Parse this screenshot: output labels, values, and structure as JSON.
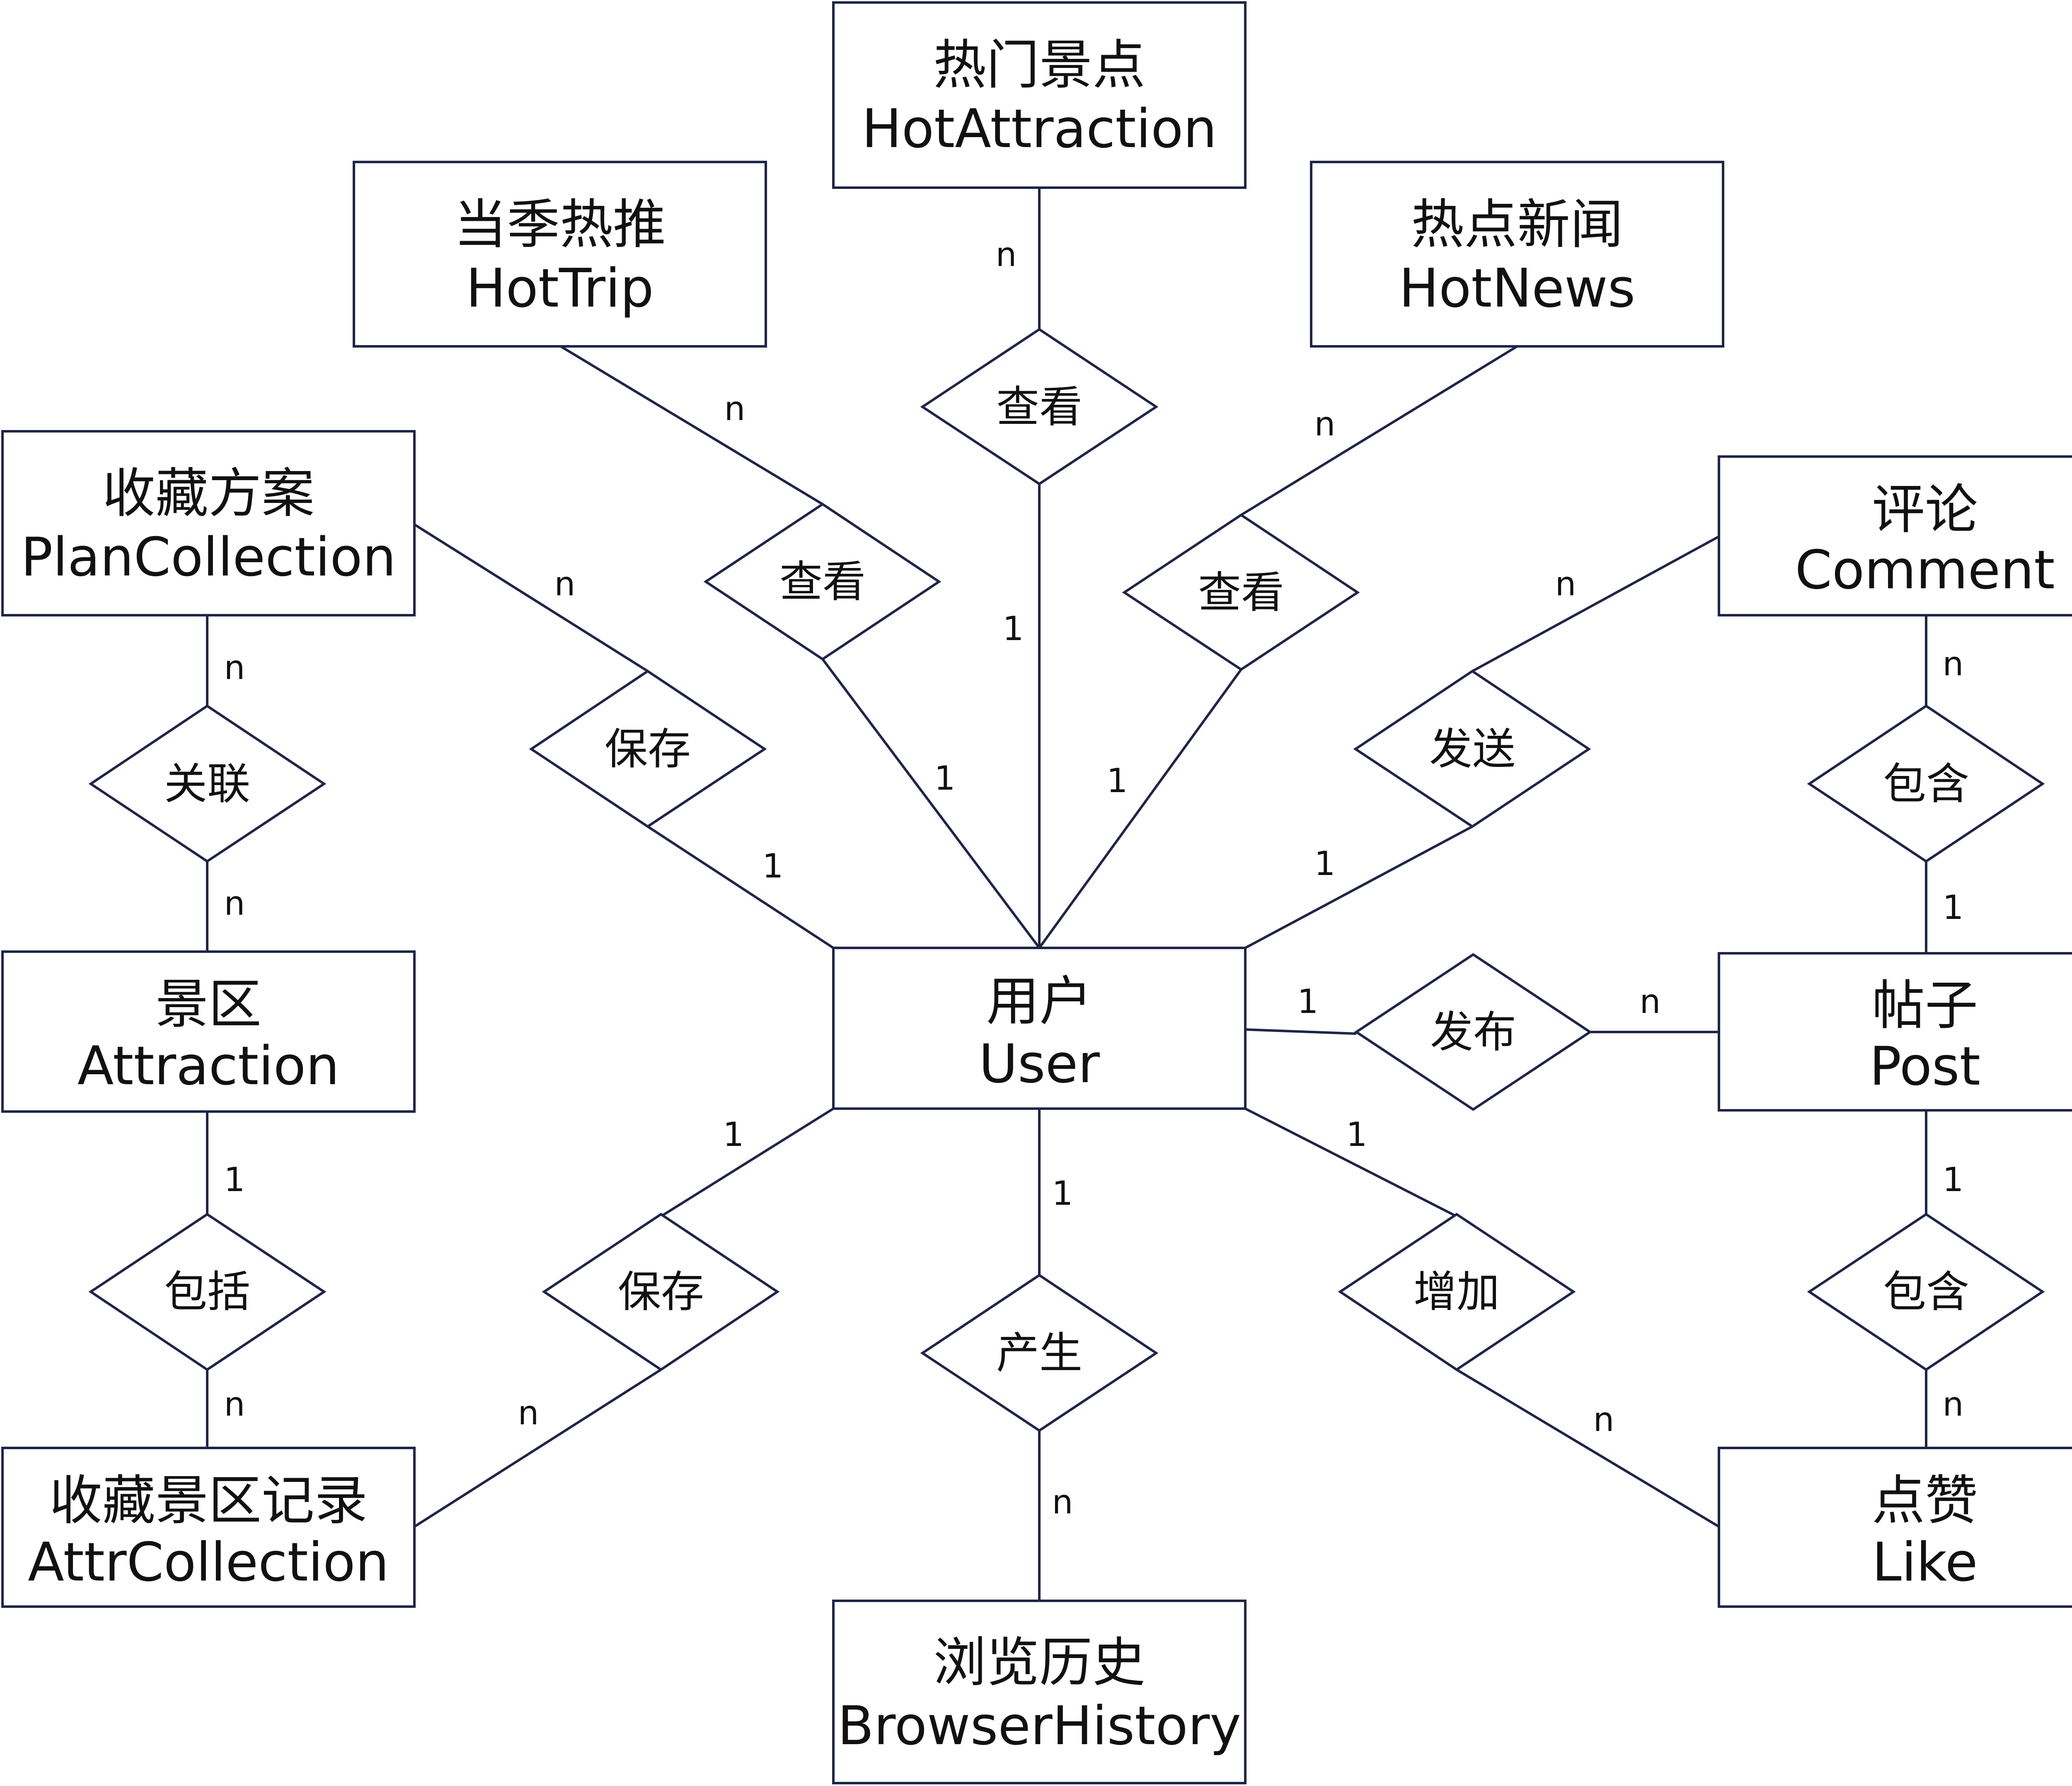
{
  "diagram": {
    "entities": {
      "user": {
        "cn": "用户",
        "en": "User"
      },
      "hotattr": {
        "cn": "热门景点",
        "en": "HotAttraction"
      },
      "hottrip": {
        "cn": "当季热推",
        "en": "HotTrip"
      },
      "hotnews": {
        "cn": "热点新闻",
        "en": "HotNews"
      },
      "plancol": {
        "cn": "收藏方案",
        "en": "PlanCollection"
      },
      "comment": {
        "cn": "评论",
        "en": "Comment"
      },
      "attr": {
        "cn": "景区",
        "en": "Attraction"
      },
      "post": {
        "cn": "帖子",
        "en": "Post"
      },
      "attrcol": {
        "cn": "收藏景区记录",
        "en": "AttrCollection"
      },
      "history": {
        "cn": "浏览历史",
        "en": "BrowserHistory"
      },
      "like": {
        "cn": "点赞",
        "en": "Like"
      }
    },
    "relationships": {
      "view_hotattr": {
        "label": "查看"
      },
      "view_hottrip": {
        "label": "查看"
      },
      "view_hotnews": {
        "label": "查看"
      },
      "save_plan": {
        "label": "保存"
      },
      "send_comment": {
        "label": "发送"
      },
      "relate": {
        "label": "关联"
      },
      "contain_comment": {
        "label": "包含"
      },
      "publish": {
        "label": "发布"
      },
      "include": {
        "label": "包括"
      },
      "save_attr": {
        "label": "保存"
      },
      "produce": {
        "label": "产生"
      },
      "add_like": {
        "label": "增加"
      },
      "contain_like": {
        "label": "包含"
      }
    },
    "cardinalities": {
      "c1": "n",
      "c2": "1",
      "c3": "n",
      "c4": "1",
      "c5": "n",
      "c6": "1",
      "c7": "n",
      "c8": "1",
      "c9": "n",
      "c10": "1",
      "c11": "n",
      "c12": "n",
      "c13": "n",
      "c14": "1",
      "c15": "1",
      "c16": "n",
      "c17": "1",
      "c18": "n",
      "c19": "1",
      "c20": "n",
      "c21": "1",
      "c22": "n",
      "c23": "1",
      "c24": "n",
      "c25": "1",
      "c26": "n"
    }
  }
}
